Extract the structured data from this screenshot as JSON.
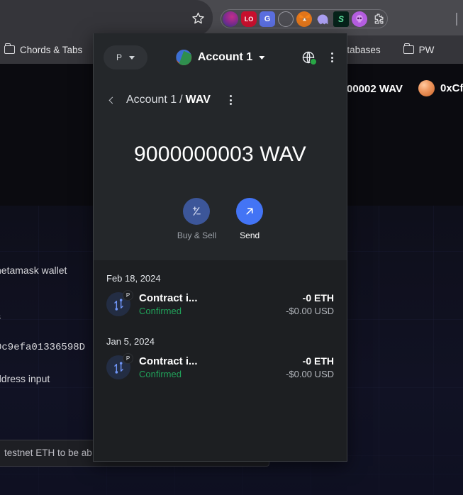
{
  "browser": {
    "star_icon": "bookmark-star-icon",
    "extensions": [
      {
        "name": "extension-purple-circle",
        "label": ""
      },
      {
        "name": "extension-lastpass",
        "label": "LO"
      },
      {
        "name": "extension-google-docs",
        "label": "G"
      },
      {
        "name": "extension-gray-circle",
        "label": ""
      },
      {
        "name": "extension-metamask",
        "label": ""
      },
      {
        "name": "extension-phantom",
        "label": ""
      },
      {
        "name": "extension-slope",
        "label": "S"
      },
      {
        "name": "extension-purple-skull",
        "label": ""
      },
      {
        "name": "extension-puzzle-menu",
        "label": ""
      }
    ],
    "bookmarks": [
      {
        "label": "Chords & Tabs"
      },
      {
        "label": "tabases"
      },
      {
        "label": "PW"
      }
    ]
  },
  "background_page": {
    "balance": "00002 WAV",
    "address": "0xCf",
    "lines": [
      "netamask wallet",
      "s",
      "0c9efa01336598D",
      "ddress input"
    ],
    "bottom_notice": "testnet ETH to be ab"
  },
  "wallet": {
    "network_pill": {
      "label": "P"
    },
    "account": {
      "name": "Account 1"
    },
    "connection_status": "connected",
    "breadcrumb": {
      "account": "Account 1",
      "separator": "/",
      "asset": "WAV"
    },
    "balance": "9000000003 WAV",
    "actions": [
      {
        "name": "buy-and-sell",
        "label": "Buy & Sell",
        "icon": "plus-minus-icon",
        "state": "disabled"
      },
      {
        "name": "send",
        "label": "Send",
        "icon": "arrow-up-right-icon",
        "state": "enabled"
      }
    ],
    "activity": [
      {
        "date": "Feb 18, 2024",
        "title": "Contract i...",
        "status": "Confirmed",
        "amount": "-0 ETH",
        "fiat": "-$0.00 USD",
        "badge": "P",
        "icon": "swap-arrows-icon"
      },
      {
        "date": "Jan 5, 2024",
        "title": "Contract i...",
        "status": "Confirmed",
        "amount": "-0 ETH",
        "fiat": "-$0.00 USD",
        "badge": "P",
        "icon": "swap-arrows-icon"
      }
    ]
  },
  "colors": {
    "accent_blue": "#4374f5",
    "success_green": "#21a35b",
    "popup_bg": "#24272a",
    "activity_bg": "#1d1f22"
  }
}
